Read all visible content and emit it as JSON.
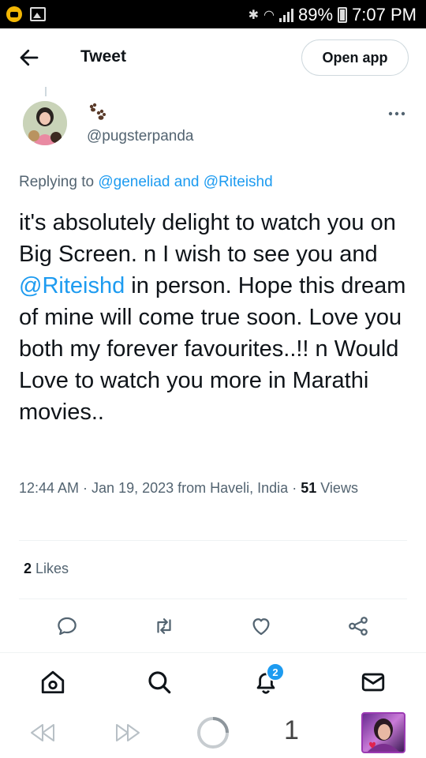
{
  "status_bar": {
    "battery": "89%",
    "time": "7:07 PM"
  },
  "header": {
    "title": "Tweet",
    "open_app_label": "Open app"
  },
  "tweet": {
    "author_handle": "@pugsterpanda",
    "display_name_icon": "paw-prints-icon",
    "replying_prefix": "Replying to",
    "replying_to": [
      "@geneliad",
      "@Riteishd"
    ],
    "replying_joiner": "and",
    "text_part1": "it's absolutely delight to watch you on Big Screen. n I wish to see you and",
    "text_mention": "@Riteishd",
    "text_part2": "in person. Hope this dream of mine will come true soon. Love you both my forever favourites..!! n Would Love to watch you more in Marathi movies..",
    "timestamp": "12:44 AM · Jan 19, 2023 from Haveli, India ·",
    "views_count": "51",
    "views_label": "Views",
    "likes_count": "2",
    "likes_label": "Likes"
  },
  "actions": [
    "reply-icon",
    "retweet-icon",
    "like-icon",
    "share-icon"
  ],
  "bottom_nav": {
    "items": [
      "home-icon",
      "search-icon",
      "notifications-icon",
      "messages-icon"
    ],
    "notifications_badge": "2"
  },
  "browser_bar": {
    "tabs_count": "1"
  },
  "colors": {
    "accent": "#1d9bf0",
    "text": "#0f1419",
    "secondary": "#536471"
  }
}
